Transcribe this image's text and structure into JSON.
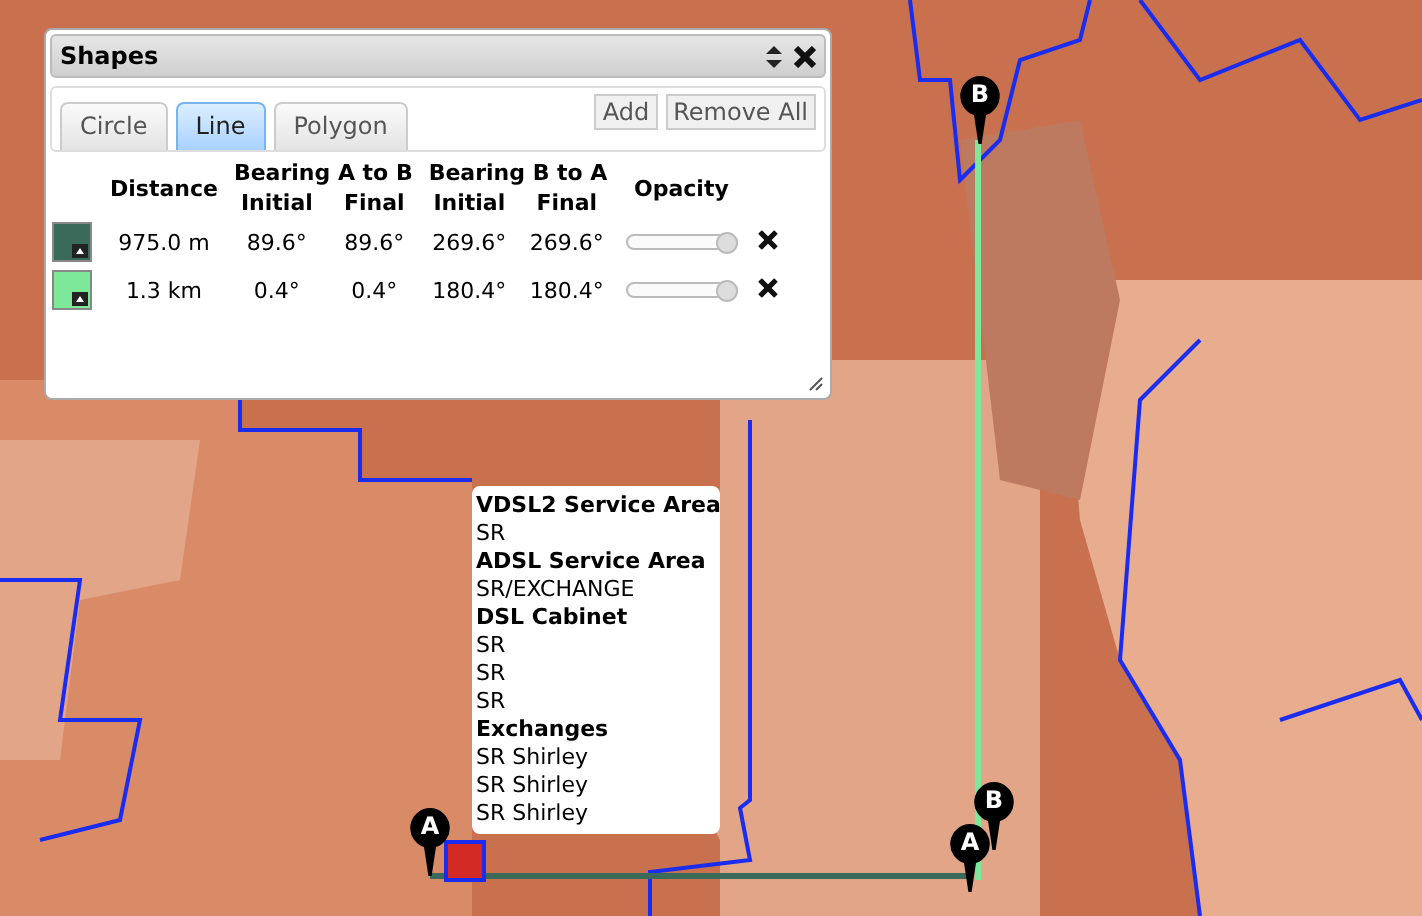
{
  "panel": {
    "title": "Shapes",
    "tabs": [
      {
        "label": "Circle",
        "selected": false
      },
      {
        "label": "Line",
        "selected": true
      },
      {
        "label": "Polygon",
        "selected": false
      }
    ],
    "buttons": [
      "Add",
      "Remove All"
    ],
    "columns": {
      "distance": "Distance",
      "bearing_ab": "Bearing A to B",
      "bearing_ba": "Bearing B to A",
      "ab_initial": "Initial",
      "ab_final": "Final",
      "ba_initial": "Initial",
      "ba_final": "Final",
      "opacity": "Opacity"
    },
    "rows": [
      {
        "color": "#3a6b5a",
        "distance": "975.0 m",
        "ab_initial": "89.6°",
        "ab_final": "89.6°",
        "ba_initial": "269.6°",
        "ba_final": "269.6°",
        "level": 1.0
      },
      {
        "color": "#7ee89a",
        "distance": "1.3 km",
        "ab_initial": "0.4°",
        "ab_final": "0.4°",
        "ba_initial": "180.4°",
        "ba_final": "180.4°",
        "level": 1.0
      }
    ]
  },
  "popup": [
    {
      "kind": "heading",
      "text": "VDSL2 Service Area"
    },
    {
      "kind": "value",
      "text": "SR"
    },
    {
      "kind": "heading",
      "text": "ADSL Service Area"
    },
    {
      "kind": "value",
      "text": "SR/EXCHANGE"
    },
    {
      "kind": "heading",
      "text": "DSL Cabinet"
    },
    {
      "kind": "value",
      "text": "SR"
    },
    {
      "kind": "value",
      "text": "SR"
    },
    {
      "kind": "value",
      "text": "SR"
    },
    {
      "kind": "heading",
      "text": "Exchanges"
    },
    {
      "kind": "value",
      "text": "SR Shirley"
    },
    {
      "kind": "value",
      "text": "SR Shirley"
    },
    {
      "kind": "value",
      "text": "SR Shirley"
    }
  ],
  "markers": [
    {
      "label": "B"
    },
    {
      "label": "A"
    },
    {
      "label": "B"
    },
    {
      "label": "A"
    }
  ]
}
